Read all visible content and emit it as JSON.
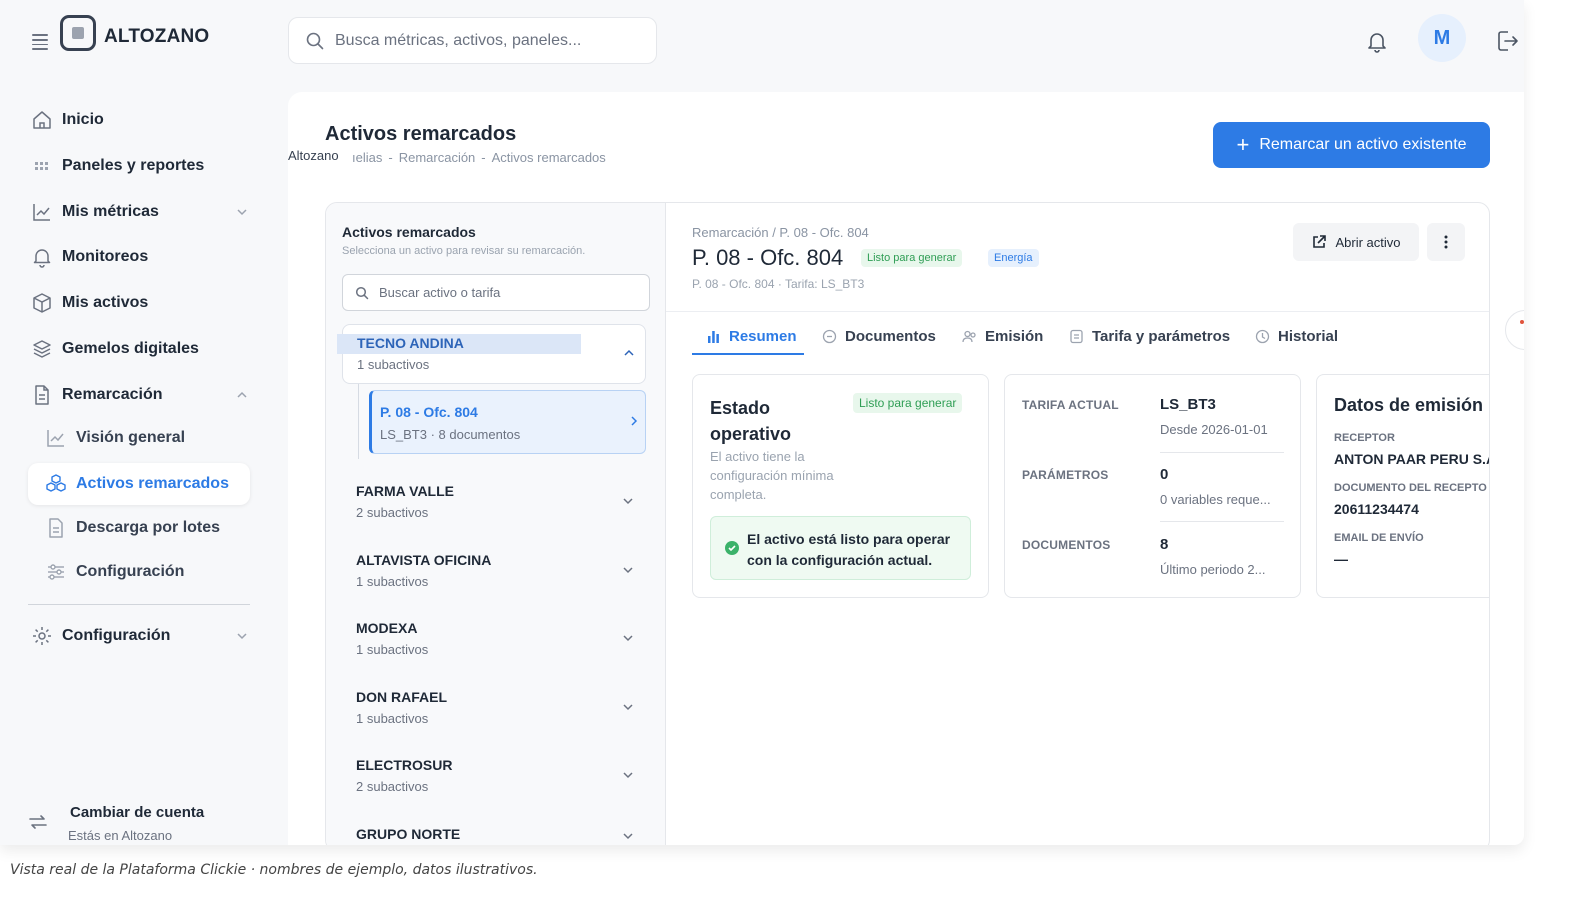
{
  "brand": {
    "name": "ALTOZANO"
  },
  "topbar": {
    "search_placeholder": "Busca métricas, activos, paneles...",
    "avatar_initial": "M"
  },
  "sidebar": {
    "items": [
      {
        "label": "Inicio",
        "icon": "home-icon"
      },
      {
        "label": "Paneles y reportes",
        "icon": "grid-icon"
      },
      {
        "label": "Mis métricas",
        "icon": "chart-line-icon"
      },
      {
        "label": "Monitoreos",
        "icon": "bell-icon"
      },
      {
        "label": "Mis activos",
        "icon": "box-icon"
      },
      {
        "label": "Gemelos digitales",
        "icon": "layers-icon"
      },
      {
        "label": "Remarcación",
        "icon": "file-icon"
      }
    ],
    "sub_items": [
      {
        "label": "Visión general",
        "icon": "chart-line-icon"
      },
      {
        "label": "Activos remarcados",
        "icon": "cubes-icon",
        "active": true
      },
      {
        "label": "Descarga por lotes",
        "icon": "document-icon"
      },
      {
        "label": "Configuración",
        "icon": "sliders-icon"
      }
    ],
    "settings": {
      "label": "Configuración",
      "icon": "gear-icon"
    },
    "account": {
      "title": "Cambiar de cuenta",
      "subtitle": "Estás en Altozano"
    }
  },
  "page": {
    "title": "Activos remarcados",
    "tooltip": "Altozano",
    "breadcrumbs": [
      "ıelias",
      "Remarcación",
      "Activos remarcados"
    ],
    "primary_button": "Remarcar un activo existente"
  },
  "list": {
    "title": "Activos remarcados",
    "subtitle": "Selecciona un activo para revisar su remarcación.",
    "search_placeholder": "Buscar activo o tarifa",
    "groups": [
      {
        "name": "TECNO ANDINA",
        "sub": "1 subactivos",
        "open": true
      },
      {
        "name": "FARMA VALLE",
        "sub": "2 subactivos"
      },
      {
        "name": "ALTAVISTA OFICINA",
        "sub": "1 subactivos"
      },
      {
        "name": "MODEXA",
        "sub": "1 subactivos"
      },
      {
        "name": "DON RAFAEL",
        "sub": "1 subactivos"
      },
      {
        "name": "ELECTROSUR",
        "sub": "2 subactivos"
      },
      {
        "name": "GRUPO NORTE",
        "sub": ""
      }
    ],
    "selected": {
      "name": "P. 08 - Ofc. 804",
      "meta": "LS_BT3 · 8 documentos"
    }
  },
  "detail": {
    "breadcrumb": "Remarcación / P. 08 - Ofc. 804",
    "title": "P. 08 - Ofc. 804",
    "badge_status": "Listo para generar",
    "badge_type": "Energía",
    "meta": "P. 08 - Ofc. 804 · Tarifa: LS_BT3",
    "open_button": "Abrir activo",
    "tabs": [
      "Resumen",
      "Documentos",
      "Emisión",
      "Tarifa y parámetros",
      "Historial"
    ],
    "status_card": {
      "title": "Estado operativo",
      "badge": "Listo para generar",
      "desc": "El activo tiene la configuración mínima completa.",
      "ok_text": "El activo está listo para operar con la configuración actual."
    },
    "tariff_card": {
      "rows": [
        {
          "key": "TARIFA ACTUAL",
          "value": "LS_BT3",
          "sub": "Desde 2026-01-01"
        },
        {
          "key": "PARÁMETROS",
          "value": "0",
          "sub": "0 variables reque..."
        },
        {
          "key": "DOCUMENTOS",
          "value": "8",
          "sub": "Último periodo 2..."
        }
      ]
    },
    "emission_card": {
      "title": "Datos de emisión",
      "fields": [
        {
          "label": "RECEPTOR",
          "value": "ANTON PAAR PERU S.A"
        },
        {
          "label": "DOCUMENTO DEL RECEPTO",
          "value": "20611234474"
        },
        {
          "label": "EMAIL DE ENVÍO",
          "value": "—"
        }
      ]
    }
  },
  "caption": "Vista real de la Plataforma Clickie · nombres de ejemplo, datos ilustrativos.",
  "colors": {
    "accent": "#2d7be5",
    "success": "#2f9e55",
    "background": "#f7f8fa"
  }
}
